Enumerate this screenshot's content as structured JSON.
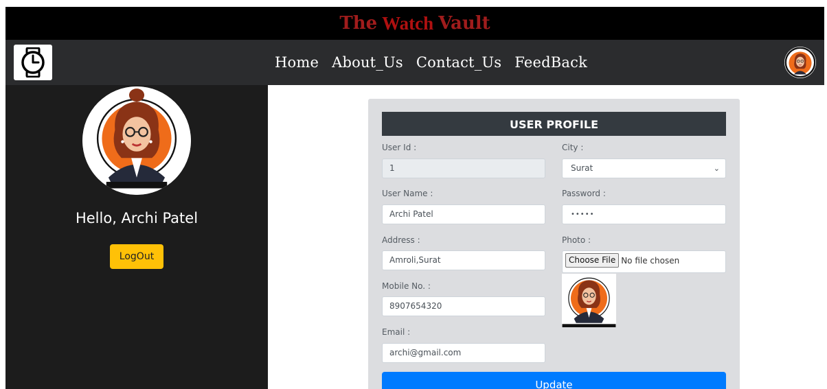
{
  "header": {
    "title_part1": "The",
    "title_part2": "Watch",
    "title_part3": "Vault"
  },
  "nav": {
    "logo_icon": "watch-icon",
    "links": [
      "Home",
      "About_Us",
      "Contact_Us",
      "FeedBack"
    ],
    "avatar_icon": "user-avatar-icon"
  },
  "sidebar": {
    "greeting": "Hello, Archi Patel",
    "logout_label": "LogOut"
  },
  "profile": {
    "header": "USER PROFILE",
    "user_id_label": "User Id :",
    "user_id_value": "1",
    "city_label": "City :",
    "city_value": "Surat",
    "user_name_label": "User Name :",
    "user_name_value": "Archi Patel",
    "password_label": "Password :",
    "password_value": "•••••",
    "address_label": "Address :",
    "address_value": "Amroli,Surat",
    "photo_label": "Photo :",
    "choose_file_label": "Choose File",
    "no_file_text": "No file chosen",
    "mobile_label": "Mobile No. :",
    "mobile_value": "8907654320",
    "email_label": "Email :",
    "email_value": "archi@gmail.com",
    "update_label": "Update"
  },
  "colors": {
    "title_red": "#a01c1c",
    "navbar": "#2b2c2e",
    "sidebar": "#1c1c1c",
    "logout_yellow": "#ffc107",
    "update_blue": "#007bff",
    "card_header": "#343a40"
  }
}
